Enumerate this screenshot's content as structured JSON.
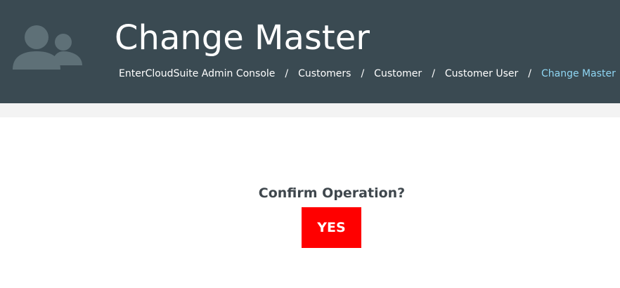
{
  "header": {
    "title": "Change Master",
    "icon": "users-icon",
    "background_color": "#3a4a52"
  },
  "breadcrumb": {
    "items": [
      {
        "label": "EnterCloudSuite Admin Console"
      },
      {
        "label": "Customers"
      },
      {
        "label": "Customer"
      },
      {
        "label": "Customer User"
      },
      {
        "label": "Change Master"
      }
    ],
    "separator": "/",
    "active_color": "#8fd6f3"
  },
  "confirm": {
    "question": "Confirm Operation?",
    "yes_label": "YES",
    "yes_color": "#ff0000"
  }
}
